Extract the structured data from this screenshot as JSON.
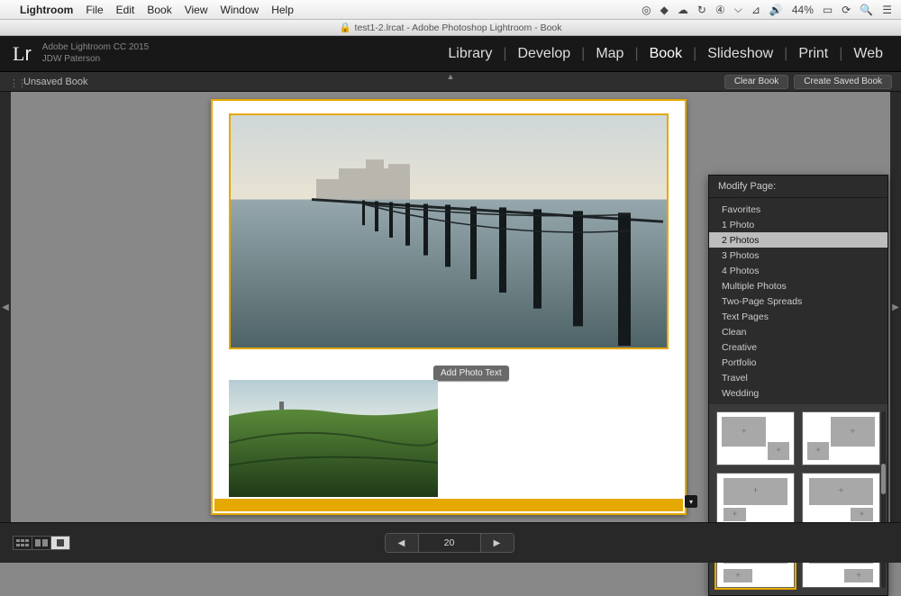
{
  "mac_menu": {
    "app": "Lightroom",
    "items": [
      "File",
      "Edit",
      "Book",
      "View",
      "Window",
      "Help"
    ],
    "battery": "44%"
  },
  "window_title": "test1-2.lrcat - Adobe Photoshop Lightroom - Book",
  "identity": {
    "product": "Adobe Lightroom CC 2015",
    "user": "JDW Paterson"
  },
  "modules": [
    "Library",
    "Develop",
    "Map",
    "Book",
    "Slideshow",
    "Print",
    "Web"
  ],
  "active_module": "Book",
  "doc_bar": {
    "title": "Unsaved Book",
    "btn_clear": "Clear Book",
    "btn_save": "Create Saved Book"
  },
  "page": {
    "photo_tag": "Add Photo Text",
    "number": "20"
  },
  "picker": {
    "title": "Modify Page:",
    "items": [
      "Favorites",
      "1 Photo",
      "2 Photos",
      "3 Photos",
      "4 Photos",
      "Multiple Photos",
      "Two-Page Spreads",
      "Text Pages",
      "Clean",
      "Creative",
      "Portfolio",
      "Travel",
      "Wedding"
    ],
    "selected": "2 Photos",
    "template_selected_index": 4
  }
}
